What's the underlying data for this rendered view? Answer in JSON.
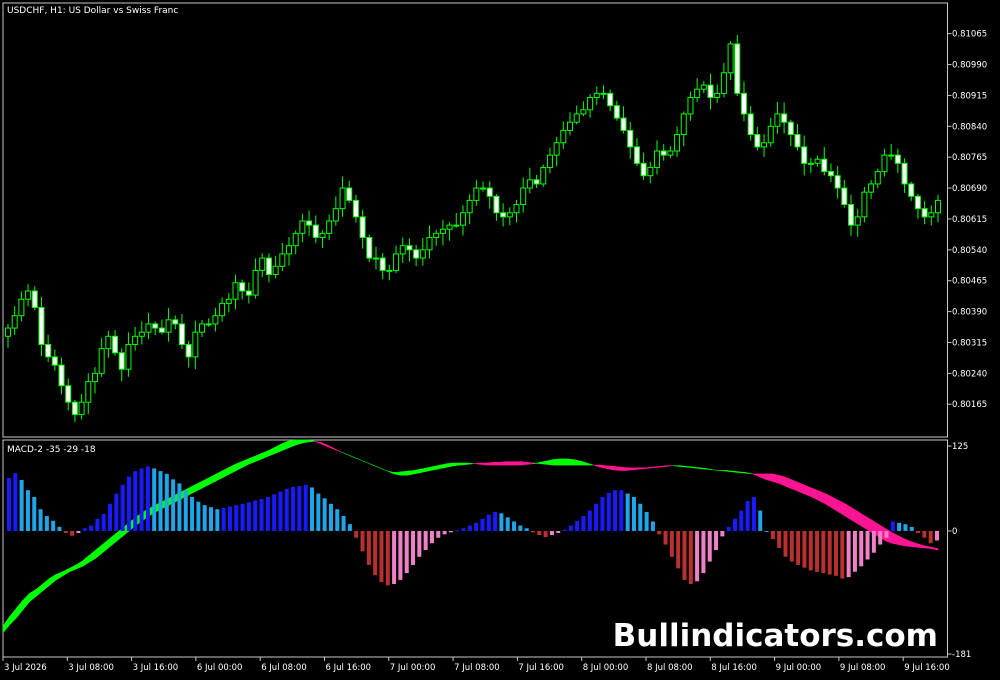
{
  "header": {
    "title": "USDCHF, H1:  US Dollar vs Swiss Franc",
    "indicator_label": "MACD-2 -35 -29 -18"
  },
  "watermark": "Bullindicators.com",
  "colors": {
    "background": "#000000",
    "frame": "#c8c8c8",
    "candle": "#00ff00",
    "candle_bull_body": "#000000",
    "candle_bear_body": "#ffffff",
    "hist_blue_strong": "#1a1aff",
    "hist_blue_light": "#1ea6e8",
    "hist_red_strong": "#b83030",
    "hist_red_light": "#f080c8",
    "band_up": "#00ff00",
    "band_down": "#ff1493"
  },
  "chart_data": [
    {
      "type": "candlestick",
      "title": "USDCHF, H1:  US Dollar vs Swiss Franc",
      "y_ticks": [
        "0.81065",
        "0.80990",
        "0.80915",
        "0.80840",
        "0.80765",
        "0.80690",
        "0.80615",
        "0.80540",
        "0.80465",
        "0.80390",
        "0.80315",
        "0.80240",
        "0.80165"
      ],
      "ylim": [
        0.801,
        0.8112
      ],
      "close": [
        0.8035,
        0.8038,
        0.8042,
        0.8044,
        0.804,
        0.8031,
        0.8028,
        0.8026,
        0.8021,
        0.8017,
        0.8014,
        0.8017,
        0.8022,
        0.8024,
        0.803,
        0.8033,
        0.8029,
        0.8025,
        0.8031,
        0.8033,
        0.8034,
        0.8036,
        0.8035,
        0.8034,
        0.8037,
        0.8036,
        0.8031,
        0.8028,
        0.8034,
        0.8036,
        0.8036,
        0.8038,
        0.8041,
        0.8042,
        0.8046,
        0.8044,
        0.8043,
        0.8049,
        0.8052,
        0.8048,
        0.805,
        0.8053,
        0.8055,
        0.8058,
        0.8061,
        0.806,
        0.8057,
        0.8058,
        0.8061,
        0.8064,
        0.8069,
        0.8066,
        0.8062,
        0.8057,
        0.8052,
        0.8052,
        0.8049,
        0.8049,
        0.8053,
        0.8055,
        0.8054,
        0.8052,
        0.8054,
        0.8057,
        0.8058,
        0.8059,
        0.806,
        0.806,
        0.8063,
        0.8066,
        0.8069,
        0.8069,
        0.8067,
        0.8063,
        0.8062,
        0.8063,
        0.8065,
        0.8069,
        0.8071,
        0.807,
        0.8074,
        0.8077,
        0.808,
        0.8083,
        0.8085,
        0.8087,
        0.8088,
        0.8091,
        0.8092,
        0.8092,
        0.8089,
        0.8086,
        0.8083,
        0.8079,
        0.8075,
        0.8072,
        0.8074,
        0.8078,
        0.8077,
        0.8078,
        0.8082,
        0.8087,
        0.8091,
        0.8093,
        0.8094,
        0.8091,
        0.8092,
        0.8097,
        0.8104,
        0.8092,
        0.8087,
        0.8082,
        0.8079,
        0.808,
        0.8084,
        0.8087,
        0.8085,
        0.8082,
        0.8079,
        0.8075,
        0.8075,
        0.8076,
        0.8073,
        0.8072,
        0.8069,
        0.8065,
        0.806,
        0.8062,
        0.8068,
        0.807,
        0.8073,
        0.8077,
        0.8077,
        0.8075,
        0.807,
        0.8067,
        0.8064,
        0.8062,
        0.8063,
        0.8066
      ],
      "x_ticks": [
        "3 Jul 2026",
        "3 Jul 08:00",
        "3 Jul 16:00",
        "6 Jul 00:00",
        "6 Jul 08:00",
        "6 Jul 16:00",
        "7 Jul 00:00",
        "7 Jul 08:00",
        "7 Jul 16:00",
        "8 Jul 00:00",
        "8 Jul 08:00",
        "8 Jul 16:00",
        "9 Jul 00:00",
        "9 Jul 08:00",
        "9 Jul 16:00"
      ],
      "grid": false
    },
    {
      "type": "bar",
      "title": "MACD-2 -35 -29 -18",
      "y_ticks": [
        "125",
        "0",
        "-181"
      ],
      "ylim": [
        -181,
        125
      ],
      "histogram": [
        78,
        85,
        75,
        60,
        50,
        32,
        22,
        15,
        6,
        -3,
        -7,
        -3,
        4,
        8,
        18,
        25,
        40,
        55,
        68,
        80,
        88,
        92,
        95,
        92,
        88,
        84,
        76,
        70,
        60,
        50,
        43,
        38,
        35,
        32,
        34,
        36,
        38,
        40,
        42,
        45,
        47,
        50,
        54,
        58,
        62,
        65,
        66,
        68,
        64,
        55,
        48,
        40,
        32,
        22,
        10,
        -10,
        -30,
        -50,
        -65,
        -75,
        -80,
        -78,
        -72,
        -62,
        -50,
        -38,
        -28,
        -18,
        -10,
        -5,
        -2,
        1,
        4,
        8,
        12,
        18,
        24,
        28,
        26,
        20,
        14,
        8,
        4,
        -2,
        -6,
        -9,
        -6,
        -3,
        2,
        8,
        15,
        22,
        30,
        40,
        50,
        56,
        60,
        60,
        55,
        50,
        40,
        28,
        14,
        -5,
        -20,
        -38,
        -55,
        -72,
        -78,
        -74,
        -62,
        -45,
        -28,
        -8,
        6,
        18,
        30,
        44,
        50,
        30,
        0,
        -12,
        -25,
        -38,
        -45,
        -50,
        -54,
        -58,
        -60,
        -62,
        -64,
        -66,
        -70,
        -68,
        -60,
        -52,
        -42,
        -32,
        -20,
        -10,
        14,
        12,
        10,
        6,
        -3,
        -10,
        -18,
        -14
      ],
      "signal_a": [
        -140,
        -126,
        -114,
        -102,
        -92,
        -86,
        -78,
        -70,
        -64,
        -60,
        -55,
        -50,
        -44,
        -36,
        -28,
        -20,
        -12,
        -4,
        4,
        12,
        20,
        27,
        33,
        38,
        43,
        48,
        53,
        58,
        63,
        68,
        73,
        78,
        83,
        88,
        93,
        98,
        102,
        106,
        110,
        114,
        118,
        123,
        128,
        132,
        134,
        134,
        134,
        132,
        128,
        124,
        120,
        116,
        112,
        108,
        104,
        100,
        96,
        92,
        88,
        86,
        87,
        88,
        89,
        91,
        93,
        95,
        97,
        99,
        100,
        100,
        100,
        99,
        98,
        97,
        97,
        97,
        97,
        97,
        97,
        98,
        99,
        101,
        103,
        105,
        106,
        106,
        105,
        103,
        100,
        97,
        94,
        92,
        90,
        89,
        89,
        90,
        91,
        92,
        93,
        94,
        95,
        96,
        96,
        95,
        94,
        93,
        92,
        90,
        89,
        89,
        88,
        87,
        86,
        84,
        80,
        76,
        73,
        70,
        66,
        62,
        58,
        54,
        50,
        45,
        40,
        34,
        28,
        22,
        16,
        10,
        4,
        -2,
        -8,
        -14,
        -18,
        -20,
        -22,
        -23,
        -24,
        -25,
        -26,
        -28
      ],
      "signal_b": [
        -150,
        -138,
        -128,
        -116,
        -104,
        -96,
        -88,
        -80,
        -72,
        -66,
        -60,
        -56,
        -52,
        -46,
        -40,
        -32,
        -24,
        -16,
        -8,
        0,
        8,
        15,
        22,
        28,
        33,
        38,
        43,
        48,
        53,
        58,
        63,
        68,
        73,
        78,
        83,
        88,
        93,
        98,
        102,
        106,
        110,
        114,
        118,
        122,
        126,
        129,
        131,
        132,
        130,
        126,
        121,
        116,
        112,
        108,
        104,
        100,
        96,
        92,
        88,
        84,
        82,
        82,
        84,
        86,
        88,
        90,
        92,
        94,
        96,
        97,
        98,
        99,
        100,
        100,
        101,
        101,
        102,
        102,
        102,
        101,
        100,
        99,
        98,
        97,
        97,
        97,
        97,
        97,
        97,
        97,
        97,
        96,
        95,
        94,
        93,
        93,
        93,
        93,
        94,
        95,
        96,
        96,
        95,
        94,
        93,
        92,
        91,
        90,
        89,
        88,
        87,
        86,
        85,
        84,
        84,
        84,
        84,
        82,
        79,
        75,
        71,
        67,
        63,
        59,
        55,
        50,
        45,
        40,
        34,
        28,
        22,
        16,
        10,
        4,
        -2,
        -7,
        -12,
        -16,
        -19,
        -22,
        -24,
        -26,
        -27
      ],
      "grid": false
    }
  ]
}
